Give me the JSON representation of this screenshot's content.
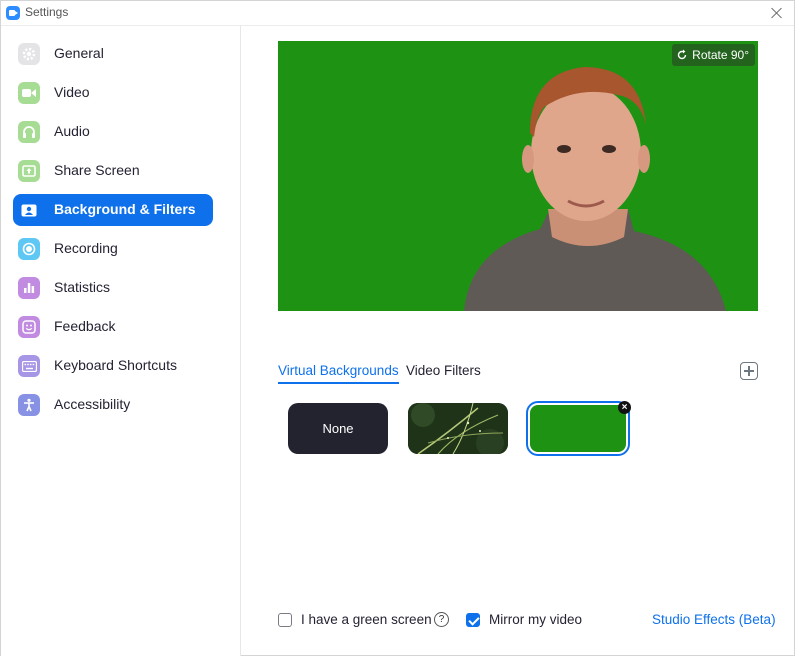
{
  "window": {
    "title": "Settings"
  },
  "sidebar": {
    "items": [
      {
        "label": "General",
        "icon": "gear-icon",
        "color": "#d9d9dc"
      },
      {
        "label": "Video",
        "icon": "video-camera-icon",
        "color": "#8fd07a"
      },
      {
        "label": "Audio",
        "icon": "headphones-icon",
        "color": "#8fd07a"
      },
      {
        "label": "Share Screen",
        "icon": "share-screen-icon",
        "color": "#8fd07a"
      },
      {
        "label": "Background & Filters",
        "icon": "person-card-icon",
        "color": "#0e71eb",
        "active": true
      },
      {
        "label": "Recording",
        "icon": "record-icon",
        "color": "#4fc3f7"
      },
      {
        "label": "Statistics",
        "icon": "bar-chart-icon",
        "color": "#b57ad6"
      },
      {
        "label": "Feedback",
        "icon": "smile-icon",
        "color": "#b57ad6"
      },
      {
        "label": "Keyboard Shortcuts",
        "icon": "keyboard-icon",
        "color": "#9b8ae0"
      },
      {
        "label": "Accessibility",
        "icon": "accessibility-icon",
        "color": "#7e8be0"
      }
    ]
  },
  "preview": {
    "rotate_label": "Rotate 90°",
    "background_color": "#1e9213"
  },
  "tabs": [
    {
      "label": "Virtual Backgrounds",
      "active": true
    },
    {
      "label": "Video Filters",
      "active": false
    }
  ],
  "backgrounds": {
    "none_label": "None",
    "items": [
      "none",
      "grass-image",
      "green-screen"
    ],
    "selected": "green-screen"
  },
  "options": {
    "green_screen_label": "I have a green screen",
    "green_screen_checked": false,
    "mirror_label": "Mirror my video",
    "mirror_checked": true,
    "studio_effects_label": "Studio Effects (Beta)"
  },
  "colors": {
    "accent": "#0e71eb",
    "green": "#1e9213"
  }
}
